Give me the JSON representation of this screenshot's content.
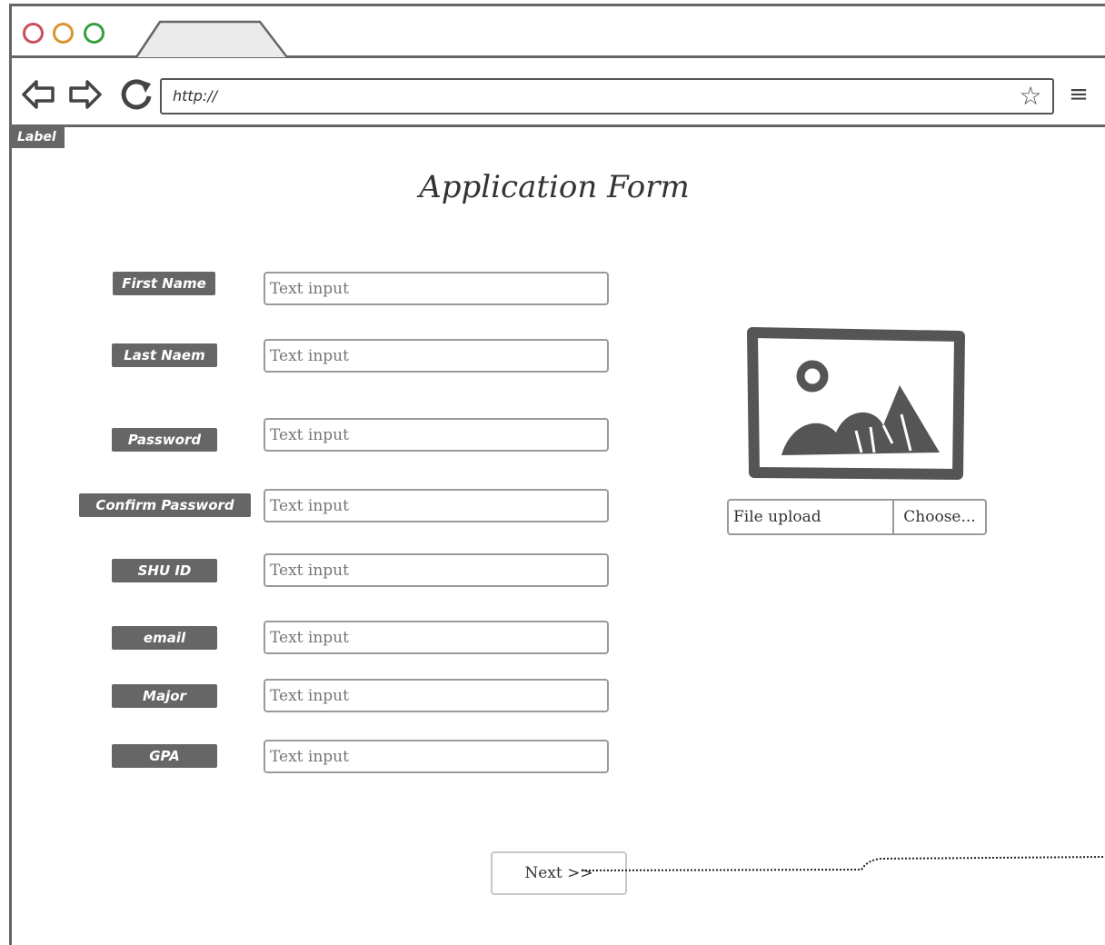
{
  "browser": {
    "url": "http://",
    "corner_label": "Label"
  },
  "form": {
    "title": "Application Form",
    "fields": [
      {
        "label": "First Name",
        "placeholder": "Text input"
      },
      {
        "label": "Last Naem",
        "placeholder": "Text input"
      },
      {
        "label": "Password",
        "placeholder": "Text input"
      },
      {
        "label": "Confirm Password",
        "placeholder": "Text input"
      },
      {
        "label": "SHU ID",
        "placeholder": "Text input"
      },
      {
        "label": "email",
        "placeholder": "Text input"
      },
      {
        "label": "Major",
        "placeholder": "Text input"
      },
      {
        "label": "GPA",
        "placeholder": "Text input"
      }
    ],
    "file_upload": {
      "text": "File upload",
      "button_label": "Choose..."
    },
    "next_button": "Next >>"
  },
  "icons": {
    "back": "back-arrow-icon",
    "forward": "forward-arrow-icon",
    "reload": "reload-icon",
    "star": "star-icon",
    "menu": "hamburger-menu-icon",
    "image": "image-placeholder-icon"
  },
  "colors": {
    "dot_red": "#c9505a",
    "dot_orange": "#d99331",
    "dot_green": "#35a040",
    "label_bg": "#666666"
  }
}
